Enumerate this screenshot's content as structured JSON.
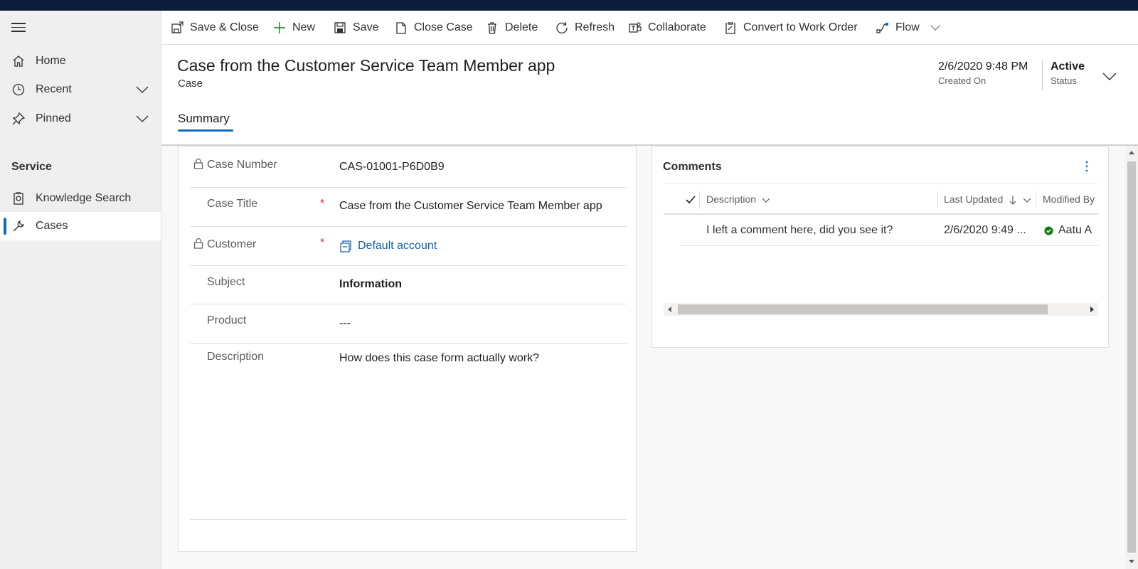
{
  "sidebar": {
    "items": [
      {
        "label": "Home",
        "icon": "home-icon"
      },
      {
        "label": "Recent",
        "icon": "clock-icon"
      },
      {
        "label": "Pinned",
        "icon": "pin-icon"
      }
    ],
    "section_title": "Service",
    "section_items": [
      {
        "label": "Knowledge Search",
        "icon": "knowledge-icon"
      },
      {
        "label": "Cases",
        "icon": "wrench-icon",
        "selected": true
      }
    ]
  },
  "commands": {
    "save_close": "Save & Close",
    "new": "New",
    "save": "Save",
    "close_case": "Close Case",
    "delete": "Delete",
    "refresh": "Refresh",
    "collaborate": "Collaborate",
    "convert": "Convert to Work Order",
    "flow": "Flow"
  },
  "header": {
    "title": "Case from the Customer Service Team Member app",
    "entity": "Case",
    "created_on_value": "2/6/2020 9:48 PM",
    "created_on_label": "Created On",
    "status_value": "Active",
    "status_label": "Status",
    "tab": "Summary"
  },
  "form": {
    "case_number_label": "Case Number",
    "case_number_value": "CAS-01001-P6D0B9",
    "case_title_label": "Case Title",
    "case_title_value": "Case from the Customer Service Team Member app",
    "customer_label": "Customer",
    "customer_value": "Default account",
    "subject_label": "Subject",
    "subject_value": "Information",
    "product_label": "Product",
    "product_value": "---",
    "description_label": "Description",
    "description_value": "How does this case form actually work?",
    "required_marker": "*"
  },
  "comments": {
    "title": "Comments",
    "columns": [
      "Description",
      "Last Updated",
      "Modified By"
    ],
    "rows": [
      {
        "description": "I left a comment here, did you see it?",
        "last_updated": "2/6/2020 9:49 ...",
        "modified_by": "Aatu A"
      }
    ]
  },
  "colors": {
    "accent": "#0f6cbd",
    "topbar": "#0f1c39",
    "link": "#115ea3",
    "required": "#d13438",
    "status_ok": "#107c10"
  }
}
